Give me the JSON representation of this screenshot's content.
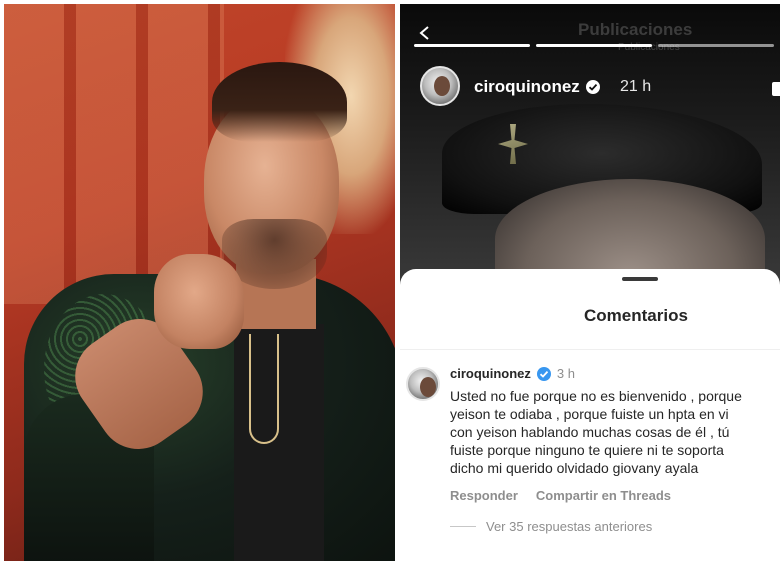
{
  "story": {
    "header_title": "Publicaciones",
    "header_subtitle": "Publicaciones",
    "username": "ciroquinonez",
    "time": "21 h",
    "progress_segments": 3
  },
  "comments_sheet": {
    "title": "Comentarios",
    "comment": {
      "username": "ciroquinonez",
      "time": "3 h",
      "text_lines": [
        "Usted no fue porque no es bienvenido , porque",
        "yeison te odiaba , porque fuiste un hpta en vi",
        "con yeison hablando muchas cosas de él , tú",
        "fuiste porque ninguno te quiere ni te soporta",
        "dicho mi querido olvidado giovany ayala"
      ],
      "reply_label": "Responder",
      "share_label": "Compartir en Threads",
      "view_replies_label": "Ver 35 respuestas anteriores"
    }
  },
  "colors": {
    "verified": "#3897f0",
    "muted_text": "#8e8e8e",
    "primary_text": "#262626"
  },
  "icons": {
    "back": "chevron-left-icon",
    "verified": "verified-badge-icon"
  }
}
